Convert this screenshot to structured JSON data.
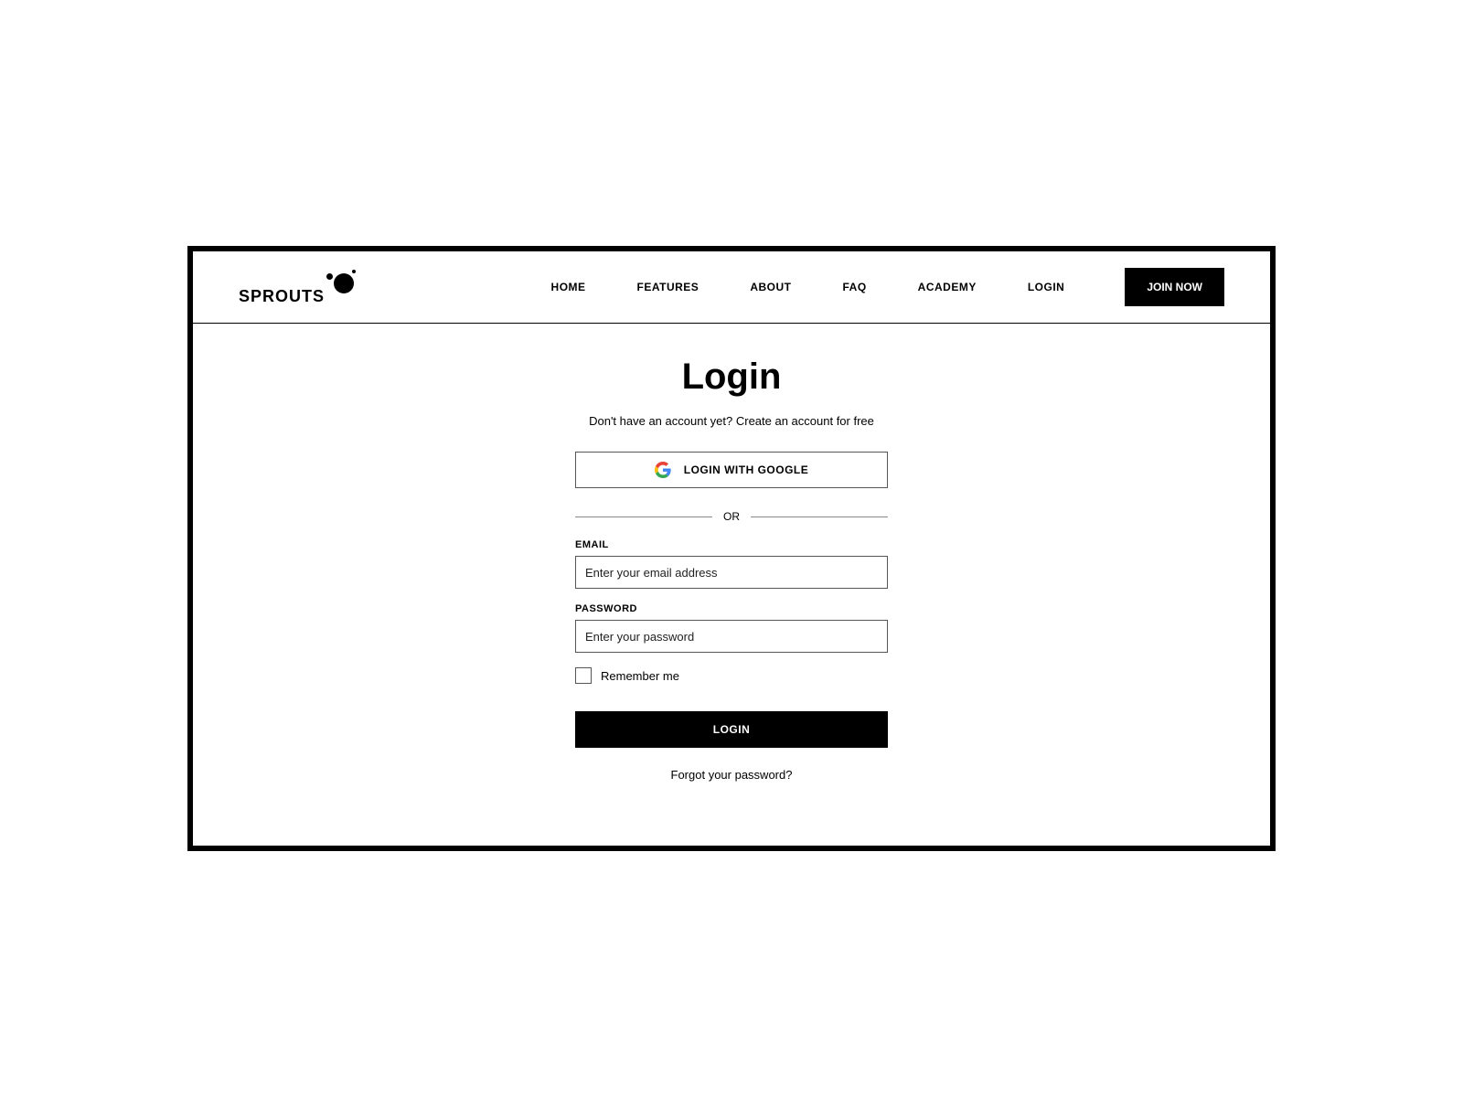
{
  "brand": "SPROUTS",
  "nav": {
    "items": [
      "HOME",
      "FEATURES",
      "ABOUT",
      "FAQ",
      "ACADEMY",
      "LOGIN"
    ],
    "cta": "JOIN NOW"
  },
  "page": {
    "title": "Login",
    "subtitle": "Don't have an account yet? Create an account for free",
    "google_button": "LOGIN WITH GOOGLE",
    "divider": "OR",
    "email_label": "EMAIL",
    "email_placeholder": "Enter your email address",
    "password_label": "PASSWORD",
    "password_placeholder": "Enter your password",
    "remember_label": "Remember me",
    "login_button": "LOGIN",
    "forgot_link": "Forgot your password?"
  }
}
